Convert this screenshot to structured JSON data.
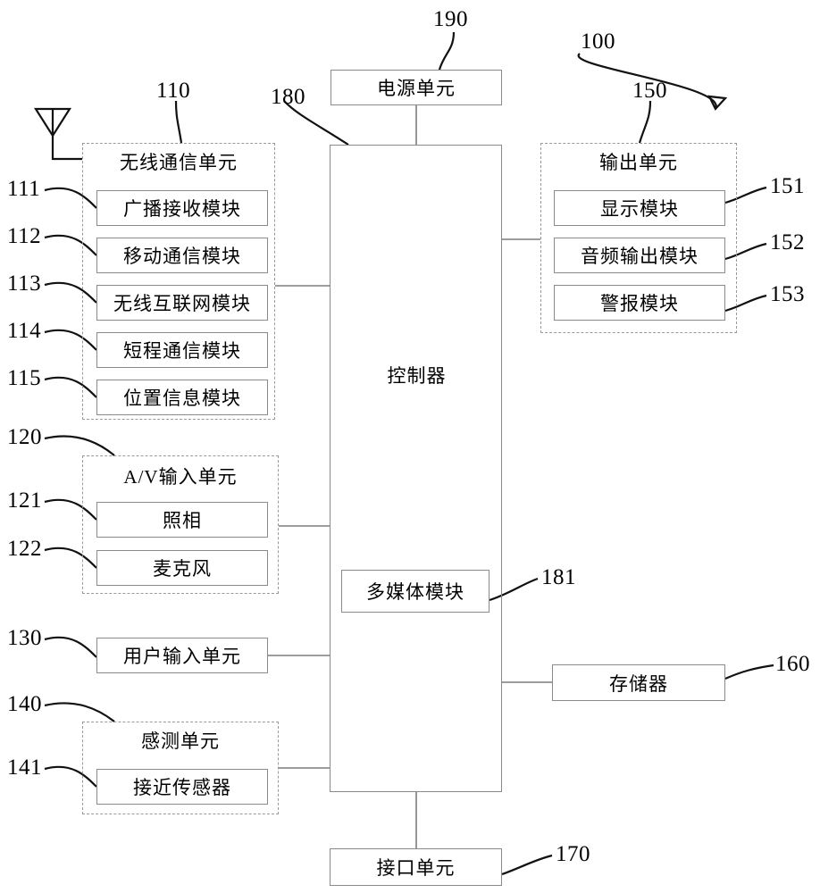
{
  "figure": {
    "type": "patent-block-diagram",
    "overall_ref": "100"
  },
  "blocks": {
    "power_unit": {
      "label": "电源单元",
      "ref": "190"
    },
    "controller": {
      "label": "控制器",
      "ref": "180"
    },
    "multimedia_module": {
      "label": "多媒体模块",
      "ref": "181"
    },
    "interface_unit": {
      "label": "接口单元",
      "ref": "170"
    },
    "memory": {
      "label": "存储器",
      "ref": "160"
    },
    "user_input_unit": {
      "label": "用户输入单元",
      "ref": "130"
    }
  },
  "wireless_unit": {
    "title": "无线通信单元",
    "ref": "110",
    "modules": [
      {
        "label": "广播接收模块",
        "ref": "111"
      },
      {
        "label": "移动通信模块",
        "ref": "112"
      },
      {
        "label": "无线互联网模块",
        "ref": "113"
      },
      {
        "label": "短程通信模块",
        "ref": "114"
      },
      {
        "label": "位置信息模块",
        "ref": "115"
      }
    ]
  },
  "av_input_unit": {
    "title": "A/V输入单元",
    "ref": "120",
    "modules": [
      {
        "label": "照相",
        "ref": "121"
      },
      {
        "label": "麦克风",
        "ref": "122"
      }
    ]
  },
  "sensing_unit": {
    "title": "感测单元",
    "ref": "140",
    "modules": [
      {
        "label": "接近传感器",
        "ref": "141"
      }
    ]
  },
  "output_unit": {
    "title": "输出单元",
    "ref": "150",
    "modules": [
      {
        "label": "显示模块",
        "ref": "151"
      },
      {
        "label": "音频输出模块",
        "ref": "152"
      },
      {
        "label": "警报模块",
        "ref": "153"
      }
    ]
  },
  "icons": {
    "antenna": "antenna-icon",
    "overall_arrow": "arrow-icon"
  },
  "colors": {
    "stroke": "#7d7d7d",
    "leader": "#111111",
    "dashed": "#9a9a9a",
    "background": "#ffffff"
  }
}
